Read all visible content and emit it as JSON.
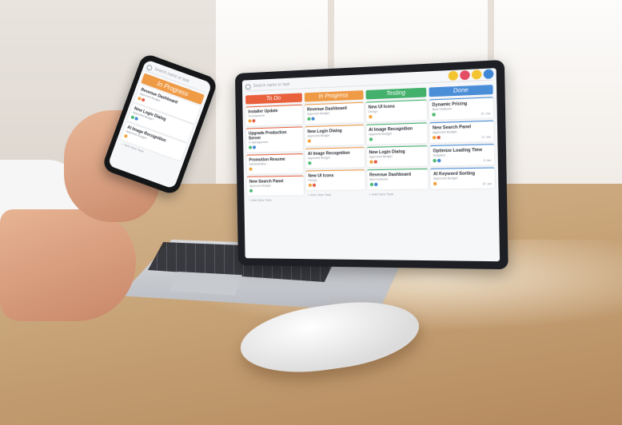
{
  "colors": {
    "todo": "#e8603c",
    "in_progress": "#ef9a45",
    "testing": "#43b06b",
    "done": "#4b8ed8",
    "dot_orange": "#f1a33a",
    "dot_red": "#e45b45",
    "dot_green": "#4dbb73",
    "dot_blue": "#3f86d4"
  },
  "laptop_app": {
    "search_placeholder": "Search name or task",
    "columns": [
      {
        "title": "To Do",
        "cards": [
          {
            "title": "Installer Update",
            "sub": "Development",
            "date": ""
          },
          {
            "title": "Upgrade Production Server",
            "sub": "IT Management",
            "date": ""
          },
          {
            "title": "Promotion Resume",
            "sub": "Administration",
            "date": ""
          },
          {
            "title": "New Search Panel",
            "sub": "Approved Budget",
            "date": ""
          }
        ],
        "add_task": "+ Add New Task"
      },
      {
        "title": "In Progress",
        "cards": [
          {
            "title": "Revenue Dashboard",
            "sub": "Approved Budget",
            "date": ""
          },
          {
            "title": "New Login Dialog",
            "sub": "Approved Budget",
            "date": ""
          },
          {
            "title": "AI Image Recognition",
            "sub": "Approved Budget",
            "date": ""
          },
          {
            "title": "New UI Icons",
            "sub": "Design",
            "date": ""
          }
        ],
        "add_task": "+ Add New Task"
      },
      {
        "title": "Testing",
        "cards": [
          {
            "title": "New UI Icons",
            "sub": "Design",
            "date": ""
          },
          {
            "title": "AI Image Recognition",
            "sub": "Approved Budget",
            "date": ""
          },
          {
            "title": "New Login Dialog",
            "sub": "Approved Budget",
            "date": ""
          },
          {
            "title": "Revenue Dashboard",
            "sub": "New Features",
            "date": ""
          }
        ],
        "add_task": "+ Add New Task"
      },
      {
        "title": "Done",
        "cards": [
          {
            "title": "Dynamic Pricing",
            "sub": "New Features",
            "date": "31 Jan"
          },
          {
            "title": "New Search Panel",
            "sub": "Approved Budget",
            "date": "12 Jan"
          },
          {
            "title": "Optimize Loading Time",
            "sub": "Analytics",
            "date": "8 Jan"
          },
          {
            "title": "AI Keyword Sorting",
            "sub": "Approved Budget",
            "date": "30 Jan"
          }
        ],
        "add_task": ""
      }
    ]
  },
  "phone_app": {
    "search_placeholder": "Search name or task",
    "column_title": "In Progress",
    "cards": [
      {
        "title": "Revenue Dashboard",
        "sub": "Approved Budget",
        "date": ""
      },
      {
        "title": "New Login Dialog",
        "sub": "Approved Budget",
        "date": ""
      },
      {
        "title": "AI Image Recognition",
        "sub": "Approved Budget",
        "date": ""
      }
    ],
    "add_task": "+ Add New Task"
  }
}
